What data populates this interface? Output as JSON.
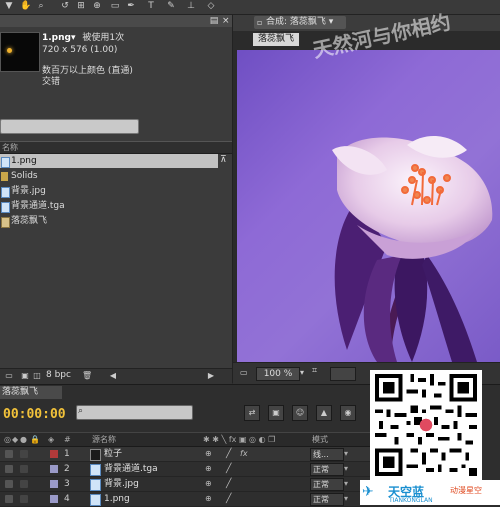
{
  "toolbar": {
    "icons": [
      "select-tool-icon",
      "hand-tool-icon",
      "zoom-tool-icon",
      "rotate-tool-icon",
      "camera-tool-icon",
      "pan-behind-icon",
      "mask-tool-icon",
      "pen-tool-icon",
      "text-tool-icon",
      "brush-tool-icon",
      "clone-tool-icon",
      "eraser-tool-icon"
    ]
  },
  "project": {
    "selected_name": "1.png▾",
    "used_times": "被使用1次",
    "dimensions": "720 x 576 (1.00)",
    "color_info": "数百万以上颜色 (直通)",
    "interlace": "交错",
    "column_name": "名称",
    "items": [
      {
        "label": "1.png",
        "icon": "image-file-icon",
        "selected": true
      },
      {
        "label": "Solids",
        "icon": "folder-icon",
        "selected": false
      },
      {
        "label": "背景.jpg",
        "icon": "image-file-icon",
        "selected": false
      },
      {
        "label": "背景通道.tga",
        "icon": "image-file-icon",
        "selected": false
      },
      {
        "label": "落蕊飘飞",
        "icon": "composition-icon",
        "selected": false
      }
    ],
    "bpc": "8 bpc"
  },
  "comp": {
    "tab_label": "合成: 落蕊飘飞 ▾",
    "sub_label": "落蕊飘飞",
    "zoom": "100 %"
  },
  "timeline": {
    "tab_label": "落蕊飘飞",
    "timecode": "00:00:00",
    "header": {
      "num": "#",
      "name": "源名称",
      "mode": "模式"
    },
    "layers": [
      {
        "num": "1",
        "name": "粒子",
        "color": "#b23a3a",
        "icon": "solid-layer-icon",
        "mode": "线..."
      },
      {
        "num": "2",
        "name": "背景通道.tga",
        "color": "#9a9ac8",
        "icon": "image-file-icon",
        "mode": "正常"
      },
      {
        "num": "3",
        "name": "背景.jpg",
        "color": "#9a9ac8",
        "icon": "image-file-icon",
        "mode": "正常"
      },
      {
        "num": "4",
        "name": "1.png",
        "color": "#9a9ac8",
        "icon": "image-file-icon",
        "mode": "正常"
      }
    ]
  },
  "watermark": "天然河与你相约",
  "logo": {
    "brand": "天空蓝",
    "sub": "TIANKONGLAN",
    "side": "动漫星空"
  },
  "colors": {
    "timecode": "#f2c23a",
    "viewer_bg": "#8466d2",
    "brand": "#1a8fd0"
  }
}
